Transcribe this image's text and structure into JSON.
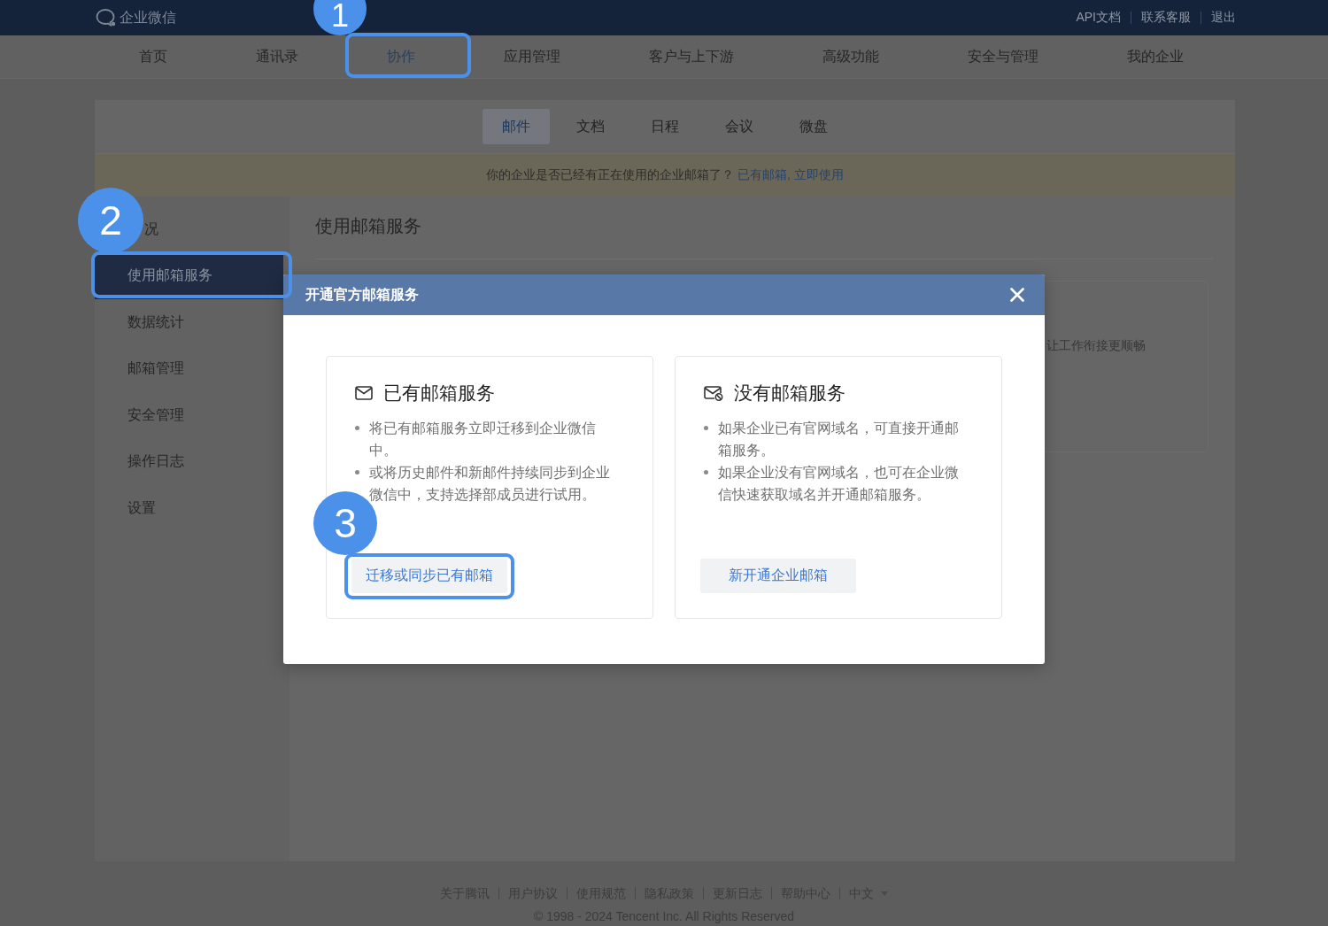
{
  "top_bar": {
    "logo_text": "企业微信",
    "links": [
      "API文档",
      "联系客服",
      "退出"
    ]
  },
  "nav": [
    {
      "label": "首页",
      "selected": false
    },
    {
      "label": "通讯录",
      "selected": false
    },
    {
      "label": "协作",
      "selected": true,
      "callout": "1"
    },
    {
      "label": "应用管理",
      "selected": false
    },
    {
      "label": "客户与上下游",
      "selected": false
    },
    {
      "label": "高级功能",
      "selected": false
    },
    {
      "label": "安全与管理",
      "selected": false
    },
    {
      "label": "我的企业",
      "selected": false
    }
  ],
  "subtabs": [
    {
      "label": "邮件",
      "selected": true
    },
    {
      "label": "文档",
      "selected": false
    },
    {
      "label": "日程",
      "selected": false
    },
    {
      "label": "会议",
      "selected": false
    },
    {
      "label": "微盘",
      "selected": false
    }
  ],
  "banner": {
    "text": "你的企业是否已经有正在使用的企业邮箱了？",
    "link": "已有邮箱, 立即使用"
  },
  "sidebar": [
    {
      "label": "况",
      "selected": false
    },
    {
      "label": "使用邮箱服务",
      "selected": true,
      "callout": "2"
    },
    {
      "label": "数据统计",
      "selected": false
    },
    {
      "label": "邮箱管理",
      "selected": false
    },
    {
      "label": "安全管理",
      "selected": false
    },
    {
      "label": "操作日志",
      "selected": false
    },
    {
      "label": "设置",
      "selected": false
    }
  ],
  "main": {
    "title": "使用邮箱服务",
    "card_text": "让工作衔接更顺畅"
  },
  "modal": {
    "title": "开通官方邮箱服务",
    "options": [
      {
        "kind": "existing",
        "title": "已有邮箱服务",
        "bullets": [
          "将已有邮箱服务立即迁移到企业微信中。",
          "或将历史邮件和新邮件持续同步到企业微信中，支持选择部成员进行试用。"
        ],
        "button": {
          "label": "迁移或同步已有邮箱",
          "callout": "3"
        }
      },
      {
        "kind": "new",
        "title": "没有邮箱服务",
        "bullets": [
          "如果企业已有官网域名，可直接开通邮箱服务。",
          "如果企业没有官网域名，也可在企业微信快速获取域名并开通邮箱服务。"
        ],
        "button": {
          "label": "新开通企业邮箱"
        }
      }
    ]
  },
  "footer": {
    "links": [
      "关于腾讯",
      "用户协议",
      "使用规范",
      "隐私政策",
      "更新日志",
      "帮助中心"
    ],
    "language": "中文",
    "copyright": "© 1998 - 2024 Tencent Inc. All Rights Reserved"
  }
}
